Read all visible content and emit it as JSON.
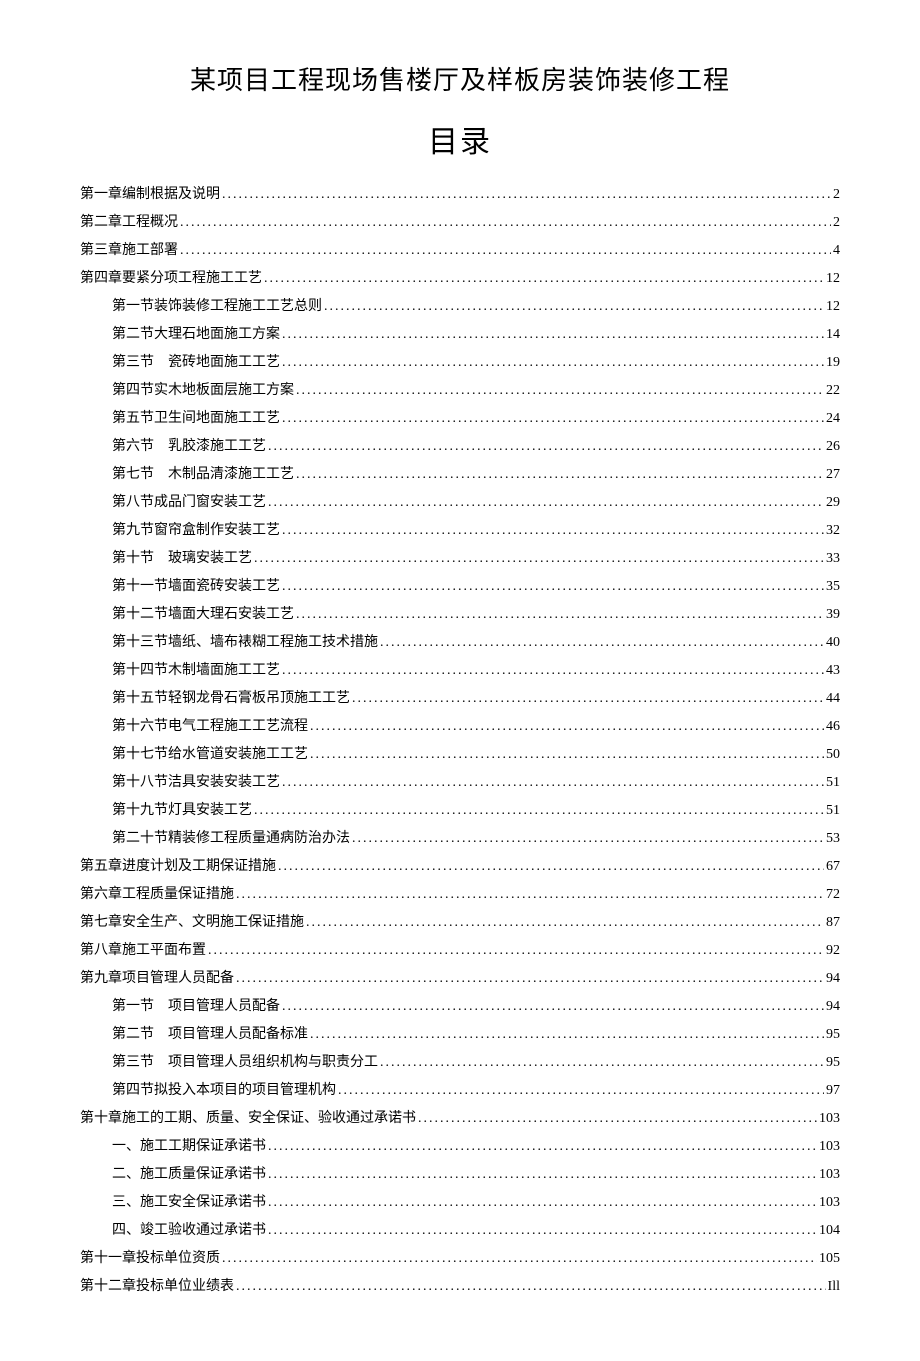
{
  "title": "某项目工程现场售楼厅及样板房装饰装修工程",
  "toc_heading": "目录",
  "entries": [
    {
      "level": 1,
      "label": "第一章编制根据及说明",
      "page": "2"
    },
    {
      "level": 1,
      "label": "第二章工程概况",
      "page": "2"
    },
    {
      "level": 1,
      "label": "第三章施工部署",
      "page": "4"
    },
    {
      "level": 1,
      "label": "第四章要紧分项工程施工工艺",
      "page": "12"
    },
    {
      "level": 2,
      "label": "第一节装饰装修工程施工工艺总则",
      "page": "12"
    },
    {
      "level": 2,
      "label": "第二节大理石地面施工方案",
      "page": "14"
    },
    {
      "level": 2,
      "label": "第三节　瓷砖地面施工工艺",
      "page": "19"
    },
    {
      "level": 2,
      "label": "第四节实木地板面层施工方案",
      "page": "22"
    },
    {
      "level": 2,
      "label": "第五节卫生间地面施工工艺",
      "page": "24"
    },
    {
      "level": 2,
      "label": "第六节　乳胶漆施工工艺",
      "page": "26"
    },
    {
      "level": 2,
      "label": "第七节　木制品清漆施工工艺",
      "page": "27"
    },
    {
      "level": 2,
      "label": "第八节成品门窗安装工艺",
      "page": "29"
    },
    {
      "level": 2,
      "label": "第九节窗帘盒制作安装工艺",
      "page": "32"
    },
    {
      "level": 2,
      "label": "第十节　玻璃安装工艺",
      "page": "33"
    },
    {
      "level": 2,
      "label": "第十一节墙面瓷砖安装工艺",
      "page": "35"
    },
    {
      "level": 2,
      "label": "第十二节墙面大理石安装工艺",
      "page": "39"
    },
    {
      "level": 2,
      "label": "第十三节墙纸、墙布裱糊工程施工技术措施",
      "page": "40"
    },
    {
      "level": 2,
      "label": "第十四节木制墙面施工工艺",
      "page": "43"
    },
    {
      "level": 2,
      "label": "第十五节轻钢龙骨石膏板吊顶施工工艺",
      "page": "44"
    },
    {
      "level": 2,
      "label": "第十六节电气工程施工工艺流程",
      "page": "46"
    },
    {
      "level": 2,
      "label": "第十七节给水管道安装施工工艺",
      "page": "50"
    },
    {
      "level": 2,
      "label": "第十八节洁具安装安装工艺",
      "page": "51"
    },
    {
      "level": 2,
      "label": "第十九节灯具安装工艺",
      "page": "51"
    },
    {
      "level": 2,
      "label": "第二十节精装修工程质量通病防治办法",
      "page": "53"
    },
    {
      "level": 1,
      "label": "第五章进度计划及工期保证措施",
      "page": "67"
    },
    {
      "level": 1,
      "label": "第六章工程质量保证措施",
      "page": "72"
    },
    {
      "level": 1,
      "label": "第七章安全生产、文明施工保证措施",
      "page": "87"
    },
    {
      "level": 1,
      "label": "第八章施工平面布置",
      "page": "92"
    },
    {
      "level": 1,
      "label": "第九章项目管理人员配备",
      "page": "94"
    },
    {
      "level": 2,
      "label": "第一节　项目管理人员配备",
      "page": "94"
    },
    {
      "level": 2,
      "label": "第二节　项目管理人员配备标准",
      "page": "95"
    },
    {
      "level": 2,
      "label": "第三节　项目管理人员组织机构与职责分工",
      "page": "95"
    },
    {
      "level": 2,
      "label": "第四节拟投入本项目的项目管理机构",
      "page": "97"
    },
    {
      "level": 1,
      "label": "第十章施工的工期、质量、安全保证、验收通过承诺书",
      "page": "103"
    },
    {
      "level": 2,
      "label": "一、施工工期保证承诺书",
      "page": "103"
    },
    {
      "level": 2,
      "label": "二、施工质量保证承诺书",
      "page": "103"
    },
    {
      "level": 2,
      "label": "三、施工安全保证承诺书",
      "page": "103"
    },
    {
      "level": 2,
      "label": "四、竣工验收通过承诺书",
      "page": "104"
    },
    {
      "level": 1,
      "label": "第十一章投标单位资质",
      "page": "105"
    },
    {
      "level": 1,
      "label": "第十二章投标单位业绩表",
      "page": "Ill"
    }
  ]
}
